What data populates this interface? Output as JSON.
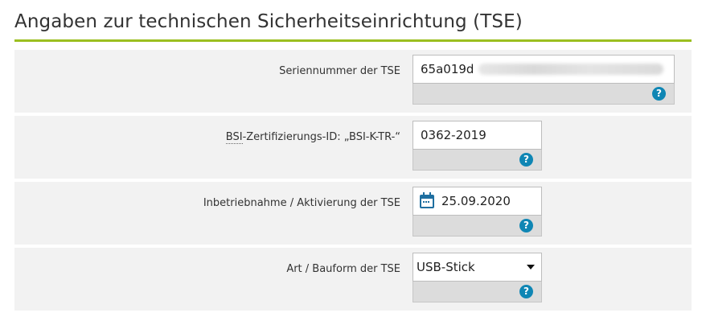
{
  "section": {
    "title": "Angaben zur technischen Sicherheitseinrichtung (TSE)"
  },
  "accent_color": "#9bbf20",
  "help_color": "#0f86b4",
  "fields": {
    "serial": {
      "label": "Seriennummer der TSE",
      "value": "65a019d",
      "help_icon": "question-icon"
    },
    "bsi": {
      "label_abbr": "BSI",
      "label_rest": "-Zertifizierungs-ID: „BSI-K-TR-“",
      "value": "0362-2019",
      "help_icon": "question-icon"
    },
    "activation": {
      "label": "Inbetriebnahme / Aktivierung der TSE",
      "value": "25.09.2020",
      "calendar_icon": "calendar-icon",
      "help_icon": "question-icon"
    },
    "type": {
      "label": "Art / Bauform der TSE",
      "value": "USB-Stick",
      "help_icon": "question-icon"
    }
  },
  "help_glyph": "?"
}
